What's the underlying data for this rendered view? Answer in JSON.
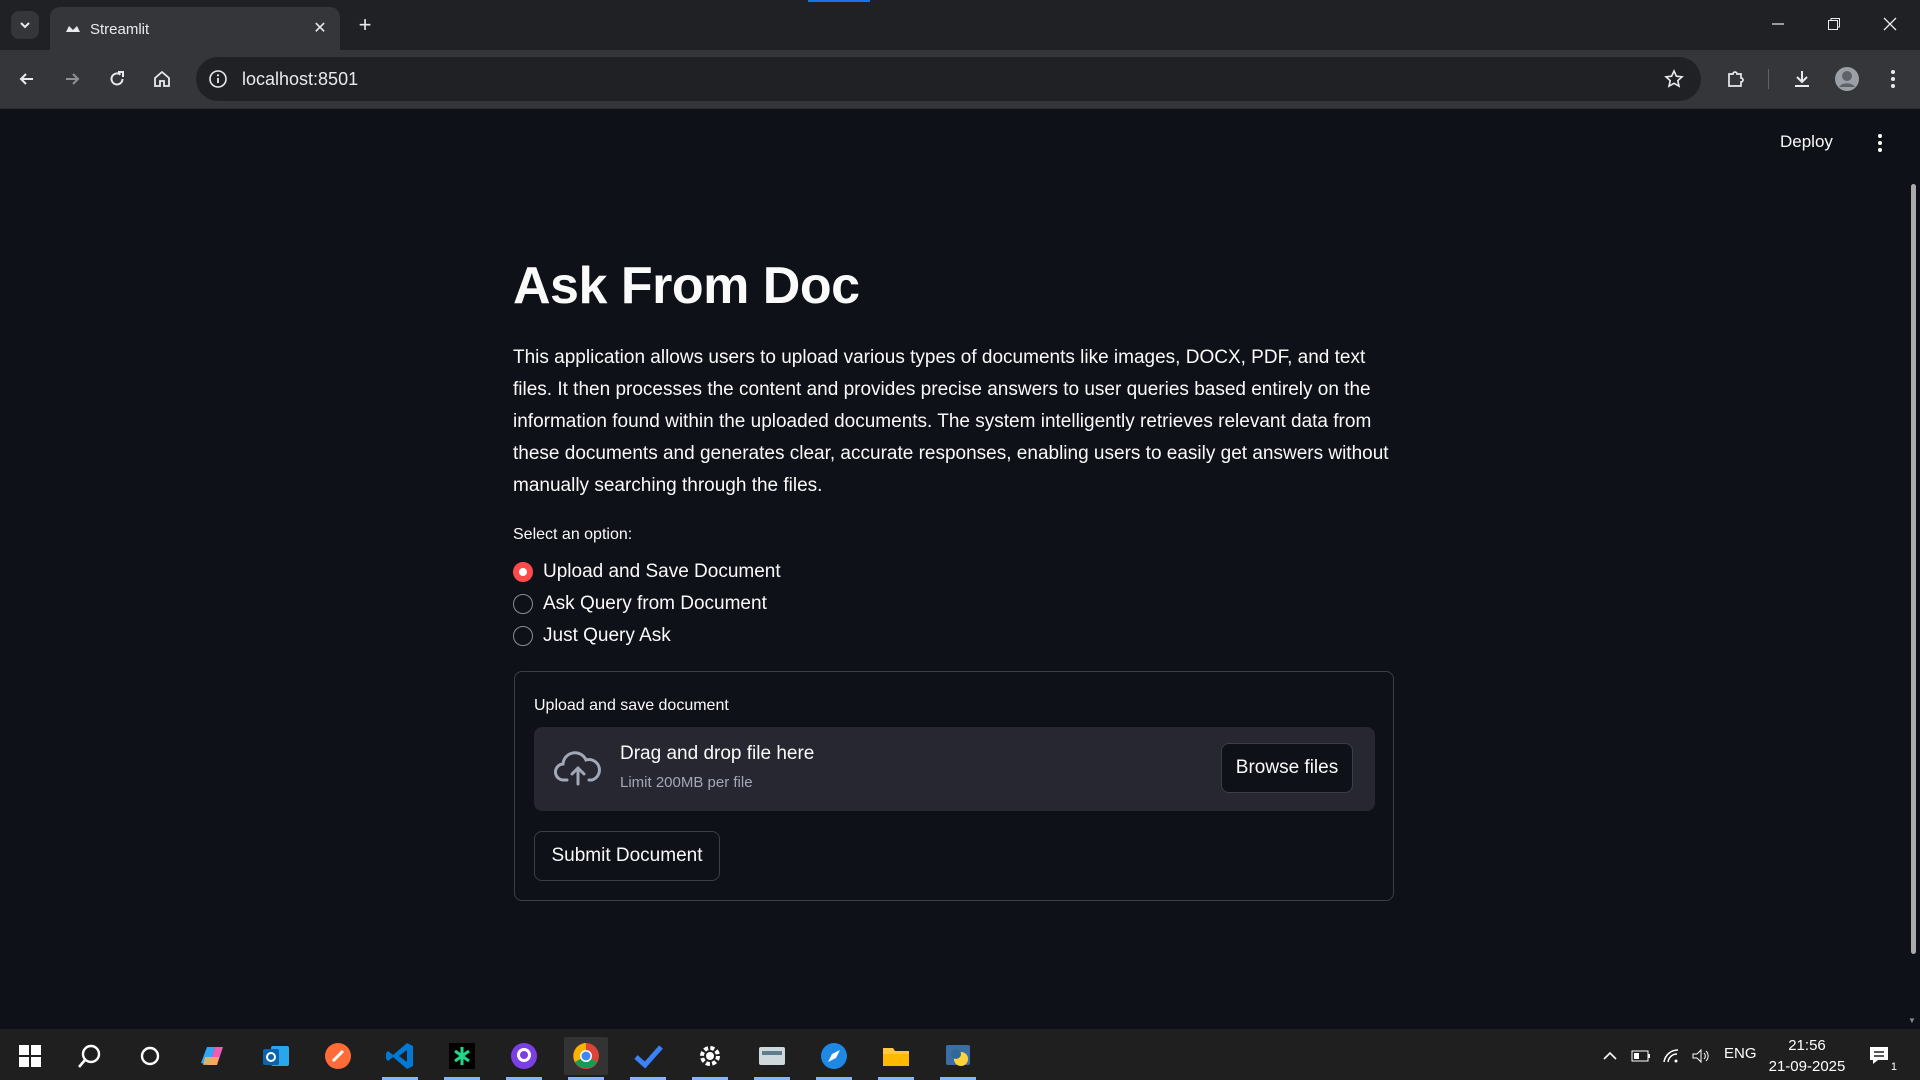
{
  "browser": {
    "tab_title": "Streamlit",
    "address": "localhost:8501"
  },
  "app": {
    "deploy_label": "Deploy",
    "title": "Ask From Doc",
    "intro": "This application allows users to upload various types of documents like images, DOCX, PDF, and text files. It then processes the content and provides precise answers to user queries based entirely on the information found within the uploaded documents. The system intelligently retrieves relevant data from these documents and generates clear, accurate responses, enabling users to easily get answers without manually searching through the files.",
    "select_label": "Select an option:",
    "options": [
      {
        "label": "Upload and Save Document",
        "selected": true
      },
      {
        "label": "Ask Query from Document",
        "selected": false
      },
      {
        "label": "Just Query Ask",
        "selected": false
      }
    ],
    "form": {
      "label": "Upload and save document",
      "dropzone_title": "Drag and drop file here",
      "dropzone_limit": "Limit 200MB per file",
      "browse_label": "Browse files",
      "submit_label": "Submit Document"
    },
    "accent_color": "#ff4b4b"
  },
  "taskbar": {
    "language": "ENG",
    "time": "21:56",
    "date": "21-09-2025",
    "notification_count": "1"
  }
}
